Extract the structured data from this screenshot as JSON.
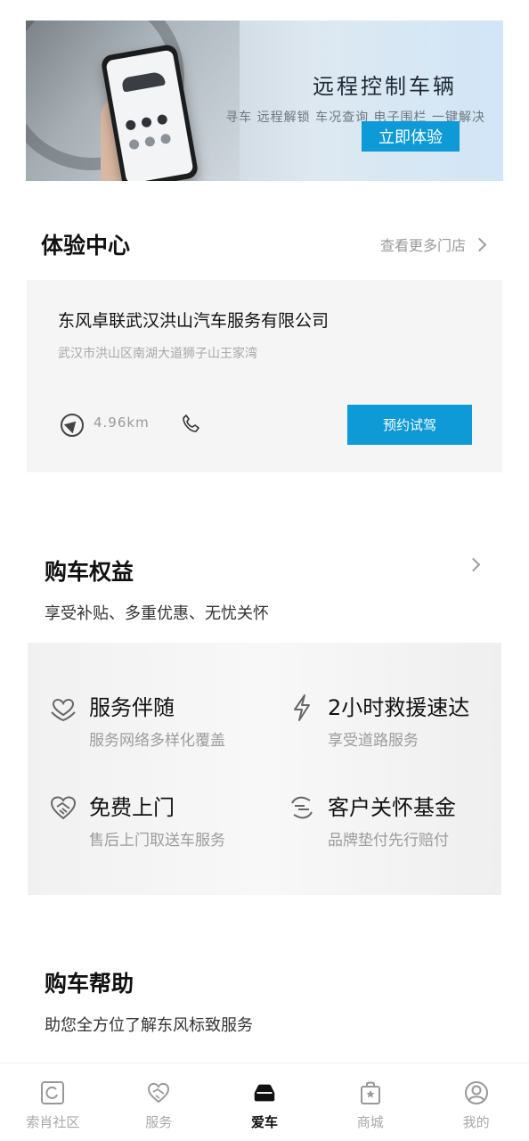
{
  "banner": {
    "title": "远程控制车辆",
    "subtitle": "寻车  远程解锁  车况查询  电子围栏  一键解决",
    "cta": "立即体验"
  },
  "experience": {
    "title": "体验中心",
    "more_link": "查看更多门店",
    "store": {
      "name": "东风卓联武汉洪山汽车服务有限公司",
      "address": "武汉市洪山区南湖大道狮子山王家湾",
      "distance": "4.96km",
      "book_button": "预约试驾"
    }
  },
  "purchase_benefits": {
    "title": "购车权益",
    "description": "享受补贴、多重优惠、无忧关怀",
    "items": [
      {
        "icon": "heart-hands-icon",
        "title": "服务伴随",
        "desc": "服务网络多样化覆盖"
      },
      {
        "icon": "lightning-icon",
        "title": "2小时救援速达",
        "desc": "享受道路服务"
      },
      {
        "icon": "handshake-icon",
        "title": "免费上门",
        "desc": "售后上门取送车服务"
      },
      {
        "icon": "exchange-icon",
        "title": "客户关怀基金",
        "desc": "品牌垫付先行赔付"
      }
    ]
  },
  "purchase_help": {
    "title": "购车帮助",
    "description": "助您全方位了解东风标致服务"
  },
  "tabbar": {
    "tabs": [
      {
        "label": "索肖社区",
        "icon": "community-icon"
      },
      {
        "label": "服务",
        "icon": "service-icon"
      },
      {
        "label": "爱车",
        "icon": "car-icon",
        "active": true
      },
      {
        "label": "商城",
        "icon": "shopping-bag-icon"
      },
      {
        "label": "我的",
        "icon": "profile-icon"
      }
    ]
  },
  "colors": {
    "accent": "#0d9ad6",
    "card_bg": "#f5f5f5",
    "muted_text": "#9c9c9c"
  }
}
